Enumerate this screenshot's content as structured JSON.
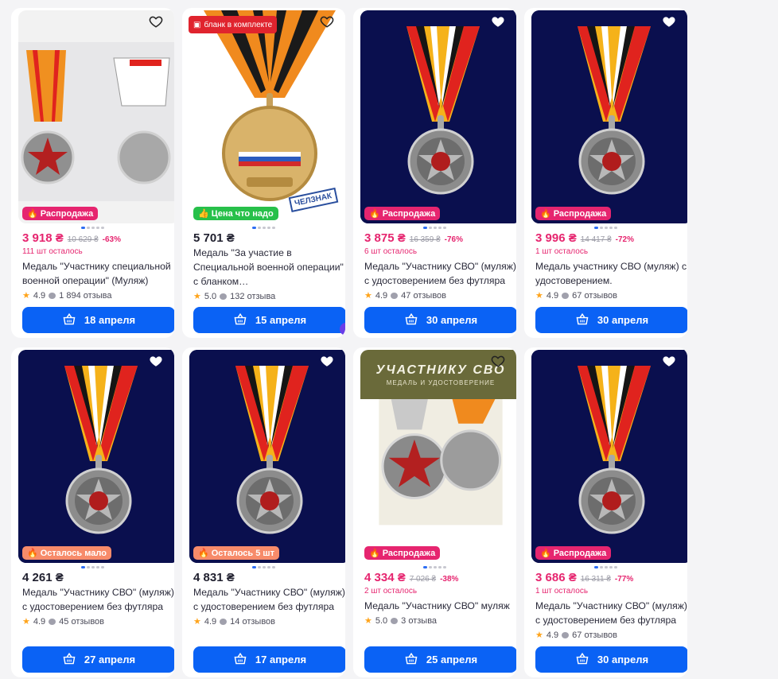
{
  "products": [
    {
      "price": "3 918 ₴",
      "old_price": "10 629 ₴",
      "discount": "-63%",
      "stock": "111 шт осталось",
      "badge": "Распродажа",
      "badge_type": "sale",
      "title": "Медаль \"Участнику специальной военной операции\" (Муляж)",
      "rating": "4.9",
      "reviews": "1 894 отзыва",
      "delivery": "18 апреля",
      "image": "light-two-medals"
    },
    {
      "price": "5 701 ₴",
      "old_price": "",
      "discount": "",
      "stock": "",
      "badge": "Цена что надо",
      "badge_type": "green",
      "ad_flag": "бланк в комплекте",
      "sticker": "ЧЕЛЗНАК",
      "title": "Медаль \"За участие в Специальной военной операции\" с бланком…",
      "rating": "5.0",
      "reviews": "132 отзыва",
      "delivery": "15 апреля",
      "image": "gold-medal"
    },
    {
      "price": "3 875 ₴",
      "old_price": "16 359 ₴",
      "discount": "-76%",
      "stock": "6 шт осталось",
      "badge": "Распродажа",
      "badge_type": "sale",
      "title": "Медаль \"Участнику СВО\" (муляж) с удостоверением без футляра",
      "rating": "4.9",
      "reviews": "47 отзывов",
      "delivery": "30 апреля",
      "image": "dark-medal"
    },
    {
      "price": "3 996 ₴",
      "old_price": "14 417 ₴",
      "discount": "-72%",
      "stock": "1 шт осталось",
      "badge": "Распродажа",
      "badge_type": "sale",
      "title": "Медаль участнику СВО (муляж) с удостоверением.",
      "rating": "4.9",
      "reviews": "67 отзывов",
      "delivery": "30 апреля",
      "image": "dark-medal"
    },
    {
      "price": "4 261 ₴",
      "old_price": "",
      "discount": "",
      "stock": "",
      "badge": "Осталось мало",
      "badge_type": "salmon",
      "title": "Медаль \"Участнику СВО\" (муляж) с удостоверением без футляра",
      "rating": "4.9",
      "reviews": "45 отзывов",
      "delivery": "27 апреля",
      "image": "dark-medal"
    },
    {
      "price": "4 831 ₴",
      "old_price": "",
      "discount": "",
      "stock": "",
      "badge": "Осталось 5 шт",
      "badge_type": "salmon",
      "title": "Медаль \"Участнику СВО\" (муляж) с удостоверением без футляра",
      "rating": "4.9",
      "reviews": "14 отзывов",
      "delivery": "17 апреля",
      "image": "dark-medal"
    },
    {
      "price": "4 334 ₴",
      "old_price": "7 026 ₴",
      "discount": "-38%",
      "stock": "2 шт осталось",
      "badge": "Распродажа",
      "badge_type": "sale",
      "banner_title": "УЧАСТНИКУ СВО",
      "banner_sub": "МЕДАЛЬ И УДОСТОВЕРЕНИЕ",
      "title": "Медаль \"Участнику СВО\" муляж",
      "rating": "5.0",
      "reviews": "3 отзыва",
      "delivery": "25 апреля",
      "image": "svo-banner"
    },
    {
      "price": "3 686 ₴",
      "old_price": "16 311 ₴",
      "discount": "-77%",
      "stock": "1 шт осталось",
      "badge": "Распродажа",
      "badge_type": "sale",
      "title": "Медаль \"Участнику СВО\" (муляж) с удостоверением без футляра",
      "rating": "4.9",
      "reviews": "67 отзывов",
      "delivery": "30 апреля",
      "image": "dark-medal"
    }
  ],
  "colors": {
    "accent": "#0a62f5",
    "sale": "#e6256f",
    "green_badge": "#27c04a",
    "salmon_badge": "#f78b6a",
    "dark_bg": "#0a0f4e"
  },
  "icons": {
    "favorite": "heart-icon",
    "cart": "basket-icon",
    "fire": "fire-icon",
    "star": "star-icon",
    "reviews": "chat-bubble-icon"
  }
}
